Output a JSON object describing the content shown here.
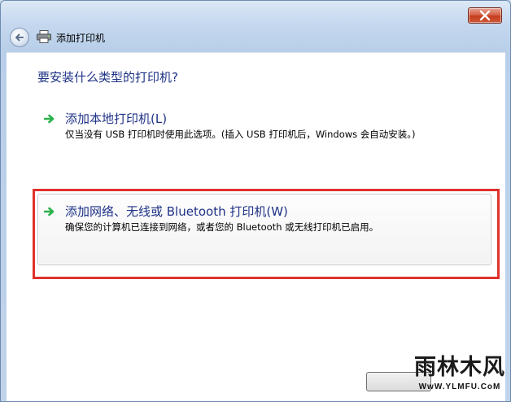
{
  "window": {
    "title": "添加打印机"
  },
  "page": {
    "question": "要安装什么类型的打印机?"
  },
  "options": [
    {
      "title": "添加本地打印机(L)",
      "description": "仅当没有 USB 打印机时使用此选项。(插入 USB 打印机后，Windows 会自动安装。)"
    },
    {
      "title": "添加网络、无线或 Bluetooth 打印机(W)",
      "description": "确保您的计算机已连接到网络，或者您的 Bluetooth 或无线打印机已启用。"
    }
  ],
  "watermark": {
    "brand": "雨林木风",
    "url": "WwW.YLMFU.CoM"
  },
  "colors": {
    "link_blue": "#1e3287",
    "arrow_green": "#2bb24c",
    "highlight_red": "#e0312b"
  },
  "icons": {
    "back": "back-arrow-icon",
    "printer": "printer-icon",
    "close": "close-icon",
    "option_arrow": "green-arrow-icon"
  }
}
